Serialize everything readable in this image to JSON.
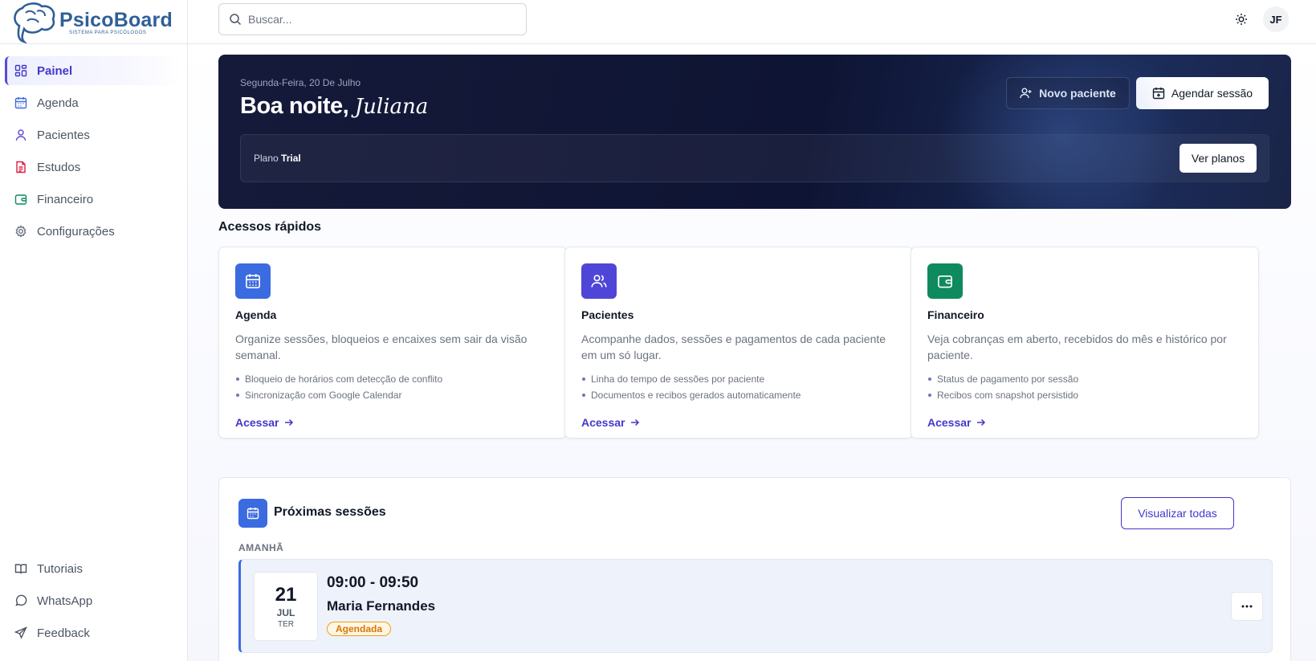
{
  "brand": {
    "name": "PsicoBoard",
    "subtitle": "SISTEMA PARA PSICÓLOGOS",
    "color": "#2f5f97"
  },
  "sidebar": {
    "items": [
      {
        "label": "Painel",
        "icon": "dashboard-icon",
        "active": true
      },
      {
        "label": "Agenda",
        "icon": "calendar-icon"
      },
      {
        "label": "Pacientes",
        "icon": "user-icon"
      },
      {
        "label": "Estudos",
        "icon": "document-icon"
      },
      {
        "label": "Financeiro",
        "icon": "wallet-icon"
      },
      {
        "label": "Configurações",
        "icon": "gear-icon"
      }
    ],
    "bottom": [
      {
        "label": "Tutoriais",
        "icon": "book-icon"
      },
      {
        "label": "WhatsApp",
        "icon": "chat-icon"
      },
      {
        "label": "Feedback",
        "icon": "send-icon"
      }
    ]
  },
  "topbar": {
    "search_placeholder": "Buscar...",
    "avatar_initials": "JF"
  },
  "hero": {
    "date": "Segunda-Feira, 20 De Julho",
    "greeting": "Boa noite,",
    "name": "Juliana",
    "new_patient_label": "Novo paciente",
    "schedule_label": "Agendar sessão",
    "plan_prefix": "Plano",
    "plan_name": "Trial",
    "plans_button": "Ver planos"
  },
  "quick_access": {
    "title": "Acessos rápidos",
    "cards": [
      {
        "title": "Agenda",
        "icon": "calendar-icon",
        "color": "#3b6be0",
        "description": "Organize sessões, bloqueios e encaixes sem sair da visão semanal.",
        "bullets": [
          "Bloqueio de horários com detecção de conflito",
          "Sincronização com Google Calendar"
        ],
        "link": "Acessar"
      },
      {
        "title": "Pacientes",
        "icon": "users-icon",
        "color": "#4f46d8",
        "description": "Acompanhe dados, sessões e pagamentos de cada paciente em um só lugar.",
        "bullets": [
          "Linha do tempo de sessões por paciente",
          "Documentos e recibos gerados automaticamente"
        ],
        "link": "Acessar"
      },
      {
        "title": "Financeiro",
        "icon": "wallet-icon",
        "color": "#0f8a5f",
        "description": "Veja cobranças em aberto, recebidos do mês e histórico por paciente.",
        "bullets": [
          "Status de pagamento por sessão",
          "Recibos com snapshot persistido"
        ],
        "link": "Acessar"
      }
    ]
  },
  "sessions": {
    "title": "Próximas sessões",
    "view_all": "Visualizar todas",
    "group_label": "AMANHÃ",
    "items": [
      {
        "day": "21",
        "month": "JUL",
        "weekday": "TER",
        "time": "09:00 - 09:50",
        "patient": "Maria Fernandes",
        "status": "Agendada"
      }
    ]
  }
}
